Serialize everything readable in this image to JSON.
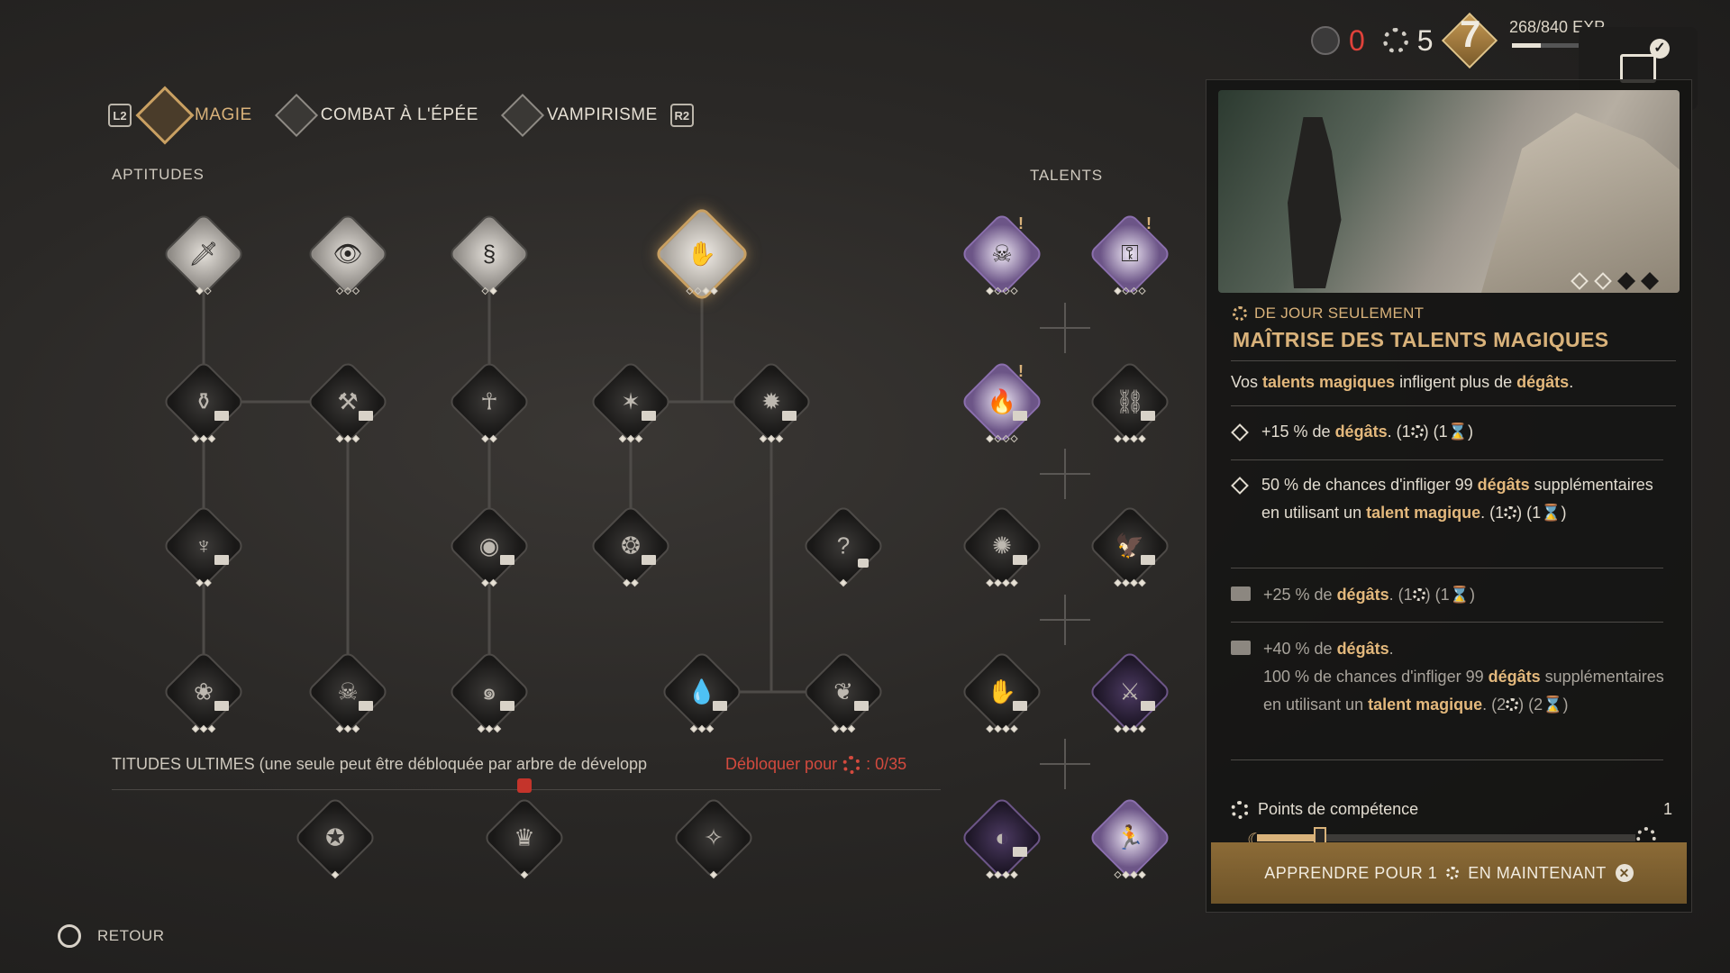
{
  "top_bar": {
    "blood_points": "0",
    "skill_points": "5",
    "level": "7",
    "exp_text": "268/840 EXP",
    "exp_progress": 0.32
  },
  "tabs": {
    "left_button": "L2",
    "right_button": "R2",
    "items": [
      {
        "label": "MAGIE",
        "active": true
      },
      {
        "label": "COMBAT À L'ÉPÉE",
        "active": false
      },
      {
        "label": "VAMPIRISME",
        "active": false
      }
    ]
  },
  "sections": {
    "aptitudes": "APTITUDES",
    "talents": "TALENTS"
  },
  "ultimate": {
    "text": "TITUDES ULTIMES (une seule peut être débloquée par arbre de développ",
    "unlock_prefix": "Débloquer pour",
    "unlock_cost": ": 0/35"
  },
  "back": {
    "label": "RETOUR"
  },
  "details": {
    "availability": "DE JOUR SEULEMENT",
    "title": "MAÎTRISE DES TALENTS MAGIQUES",
    "description_parts": [
      "Vos ",
      "talents magiques",
      " infligent plus de ",
      "dégâts",
      "."
    ],
    "perks": [
      {
        "text_a": "+15 % de ",
        "hl_a": "dégâts",
        "text_b": ". (1",
        "text_c": ") (1",
        "text_d": ")",
        "dim": false,
        "icon": "diamond-outline-icon"
      },
      {
        "text_a": "50 % de chances d'infliger 99 ",
        "hl_a": "dégâts",
        "text_b": " supplémentaires en utilisant un ",
        "hl_b": "talent magique",
        "text_c": ". (1",
        "text_d": ") (1",
        "text_e": ")",
        "dim": false,
        "icon": "diamond-outline-icon"
      },
      {
        "text_a": "+25 % de ",
        "hl_a": "dégâts",
        "text_b": ". (1",
        "text_c": ") (1",
        "text_d": ")",
        "dim": true,
        "icon": "book-icon"
      },
      {
        "text_a": "+40 % de ",
        "hl_a": "dégâts",
        "text_b": ".",
        "text_c": "100 % de chances d'infliger 99 ",
        "hl_b": "dégâts",
        "text_d": " supplémentaires en utilisant un ",
        "hl_c": "talent magique",
        "text_e": ". (2",
        "text_f": ") (2",
        "text_g": ")",
        "dim": true,
        "icon": "book-icon"
      }
    ],
    "competence_label": "Points de compétence",
    "competence_value": "1",
    "day_progress": 0.18,
    "learn_prefix": "APPRENDRE POUR 1",
    "learn_suffix": "EN MAINTENANT"
  },
  "colors": {
    "gold_accent": "#d9b27a",
    "red_alert": "#d44a3e",
    "panel_bg": "#141312"
  }
}
